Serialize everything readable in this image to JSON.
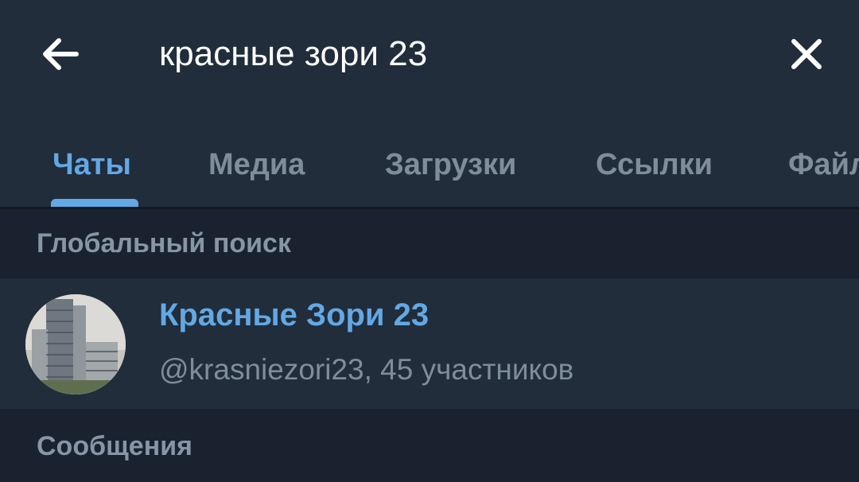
{
  "search": {
    "query": "красные зори 23"
  },
  "tabs": [
    {
      "label": "Чаты",
      "active": true
    },
    {
      "label": "Медиа",
      "active": false
    },
    {
      "label": "Загрузки",
      "active": false
    },
    {
      "label": "Ссылки",
      "active": false
    },
    {
      "label": "Файлы",
      "active": false
    }
  ],
  "sections": {
    "global_search": "Глобальный поиск",
    "messages": "Сообщения"
  },
  "result": {
    "title": "Красные Зори 23",
    "subtitle": "@krasniezori23, 45 участников"
  },
  "icons": {
    "back": "arrow-left-icon",
    "clear": "close-icon"
  },
  "colors": {
    "accent": "#62a8e4",
    "background": "#1d2733",
    "header": "#212d3b",
    "muted_text": "#7f8d9b"
  }
}
